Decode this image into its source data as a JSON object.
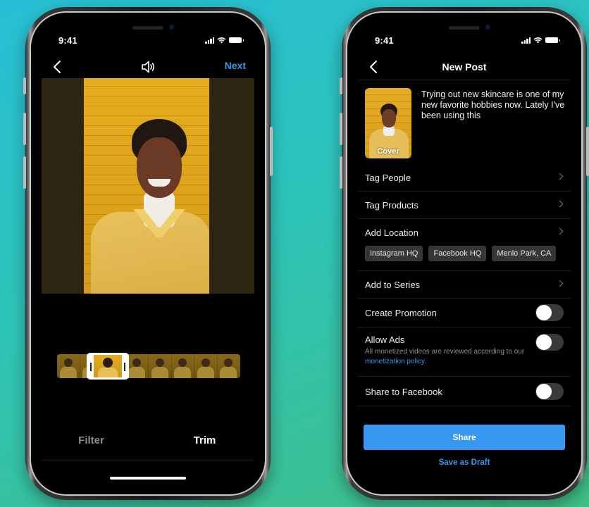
{
  "status_bar": {
    "time": "9:41"
  },
  "editor": {
    "next_label": "Next",
    "tabs": [
      {
        "label": "Filter",
        "active": false
      },
      {
        "label": "Trim",
        "active": true
      }
    ],
    "filmstrip_frames": 8
  },
  "new_post": {
    "title": "New Post",
    "caption": "Trying out new skincare is one of my new favorite hobbies now. Lately I've been using this",
    "cover_label": "Cover",
    "menu": {
      "tag_people": "Tag People",
      "tag_products": "Tag Products",
      "add_location": "Add Location",
      "add_to_series": "Add to Series"
    },
    "location_suggestions": [
      "Instagram HQ",
      "Facebook HQ",
      "Menlo Park, CA"
    ],
    "toggles": {
      "create_promotion": {
        "label": "Create Promotion",
        "on": false
      },
      "allow_ads": {
        "label": "Allow Ads",
        "on": false,
        "note_prefix": "All monetized videos are reviewed according to our ",
        "note_link": "monetization policy",
        "note_suffix": "."
      },
      "share_to_facebook": {
        "label": "Share to Facebook",
        "on": false
      }
    },
    "share_label": "Share",
    "draft_label": "Save as Draft"
  },
  "colors": {
    "accent": "#3897f0",
    "background_top": "#27bfd6",
    "background_bottom": "#40bf86"
  }
}
